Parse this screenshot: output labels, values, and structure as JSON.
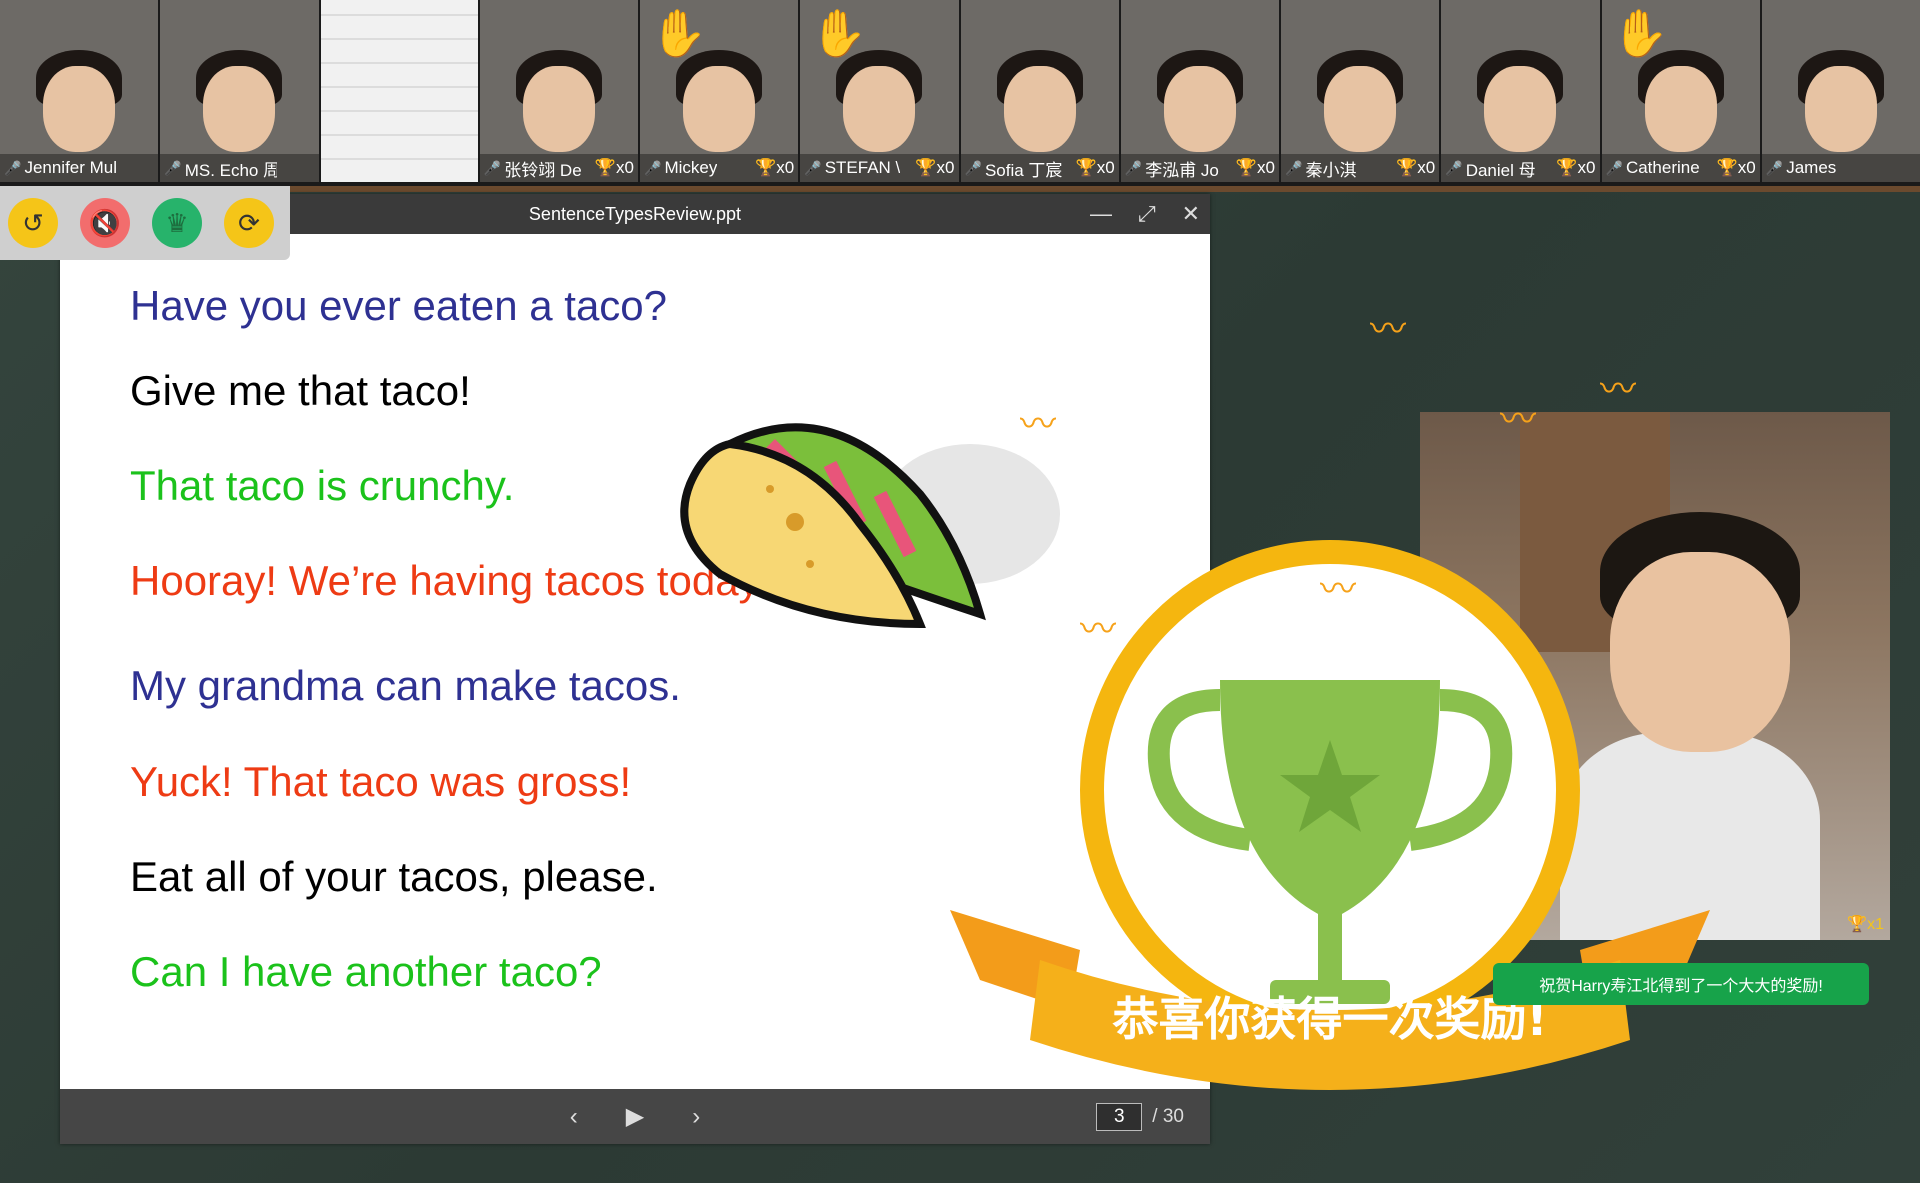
{
  "participants": [
    {
      "name": "Jennifer Mulert",
      "mic": "on",
      "hand": false,
      "trophies": ""
    },
    {
      "name": "MS. Echo 周世",
      "mic": "on",
      "hand": false,
      "trophies": ""
    },
    {
      "name": "",
      "mic": "",
      "hand": false,
      "trophies": ""
    },
    {
      "name": "张铃翊 De",
      "mic": "off",
      "hand": false,
      "trophies": "x0"
    },
    {
      "name": "Mickey",
      "mic": "off",
      "hand": true,
      "trophies": "x0"
    },
    {
      "name": "STEFAN \\",
      "mic": "off",
      "hand": true,
      "trophies": "x0"
    },
    {
      "name": "Sofia 丁宸",
      "mic": "off",
      "hand": false,
      "trophies": "x0"
    },
    {
      "name": "李泓甫 Jo",
      "mic": "off",
      "hand": false,
      "trophies": "x0"
    },
    {
      "name": "秦小淇",
      "mic": "off",
      "hand": false,
      "trophies": "x0"
    },
    {
      "name": "Daniel 母",
      "mic": "off",
      "hand": false,
      "trophies": "x0"
    },
    {
      "name": "Catherine",
      "mic": "off",
      "hand": true,
      "trophies": "x0"
    },
    {
      "name": "James",
      "mic": "off",
      "hand": false,
      "trophies": ""
    }
  ],
  "toolbar": {
    "reset_icon": "↺",
    "mute_icon": "🔇",
    "crown_icon": "♛",
    "sync_icon": "⟳"
  },
  "window": {
    "title": "SentenceTypesReview.ppt",
    "minimize": "—",
    "maximize": "⤢",
    "close": "✕"
  },
  "slide": {
    "lines": [
      {
        "text": "Have you ever eaten a taco?",
        "color": "#2e3192"
      },
      {
        "text": "Give me that taco!",
        "color": "#000000"
      },
      {
        "text": " That taco is crunchy.",
        "color": "#1bc21b"
      },
      {
        "text": "Hooray! We’re having tacos today!",
        "color": "#ee3b14"
      },
      {
        "text": "My grandma can make tacos.",
        "color": "#2e3192"
      },
      {
        "text": "Yuck! That taco was gross!",
        "color": "#ee3b14"
      },
      {
        "text": "Eat all of your tacos, please.",
        "color": "#000000"
      },
      {
        "text": "Can I have another taco?",
        "color": "#1bc21b"
      }
    ]
  },
  "pager": {
    "prev": "‹",
    "play": "▶",
    "next": "›",
    "current_page": "3",
    "total_pages": "/ 30"
  },
  "student": {
    "trophies": "x1"
  },
  "reward": {
    "banner_text": "恭喜你获得一次奖励!",
    "toast_text": "祝贺Harry寿江北得到了一个大大的奖励!"
  }
}
